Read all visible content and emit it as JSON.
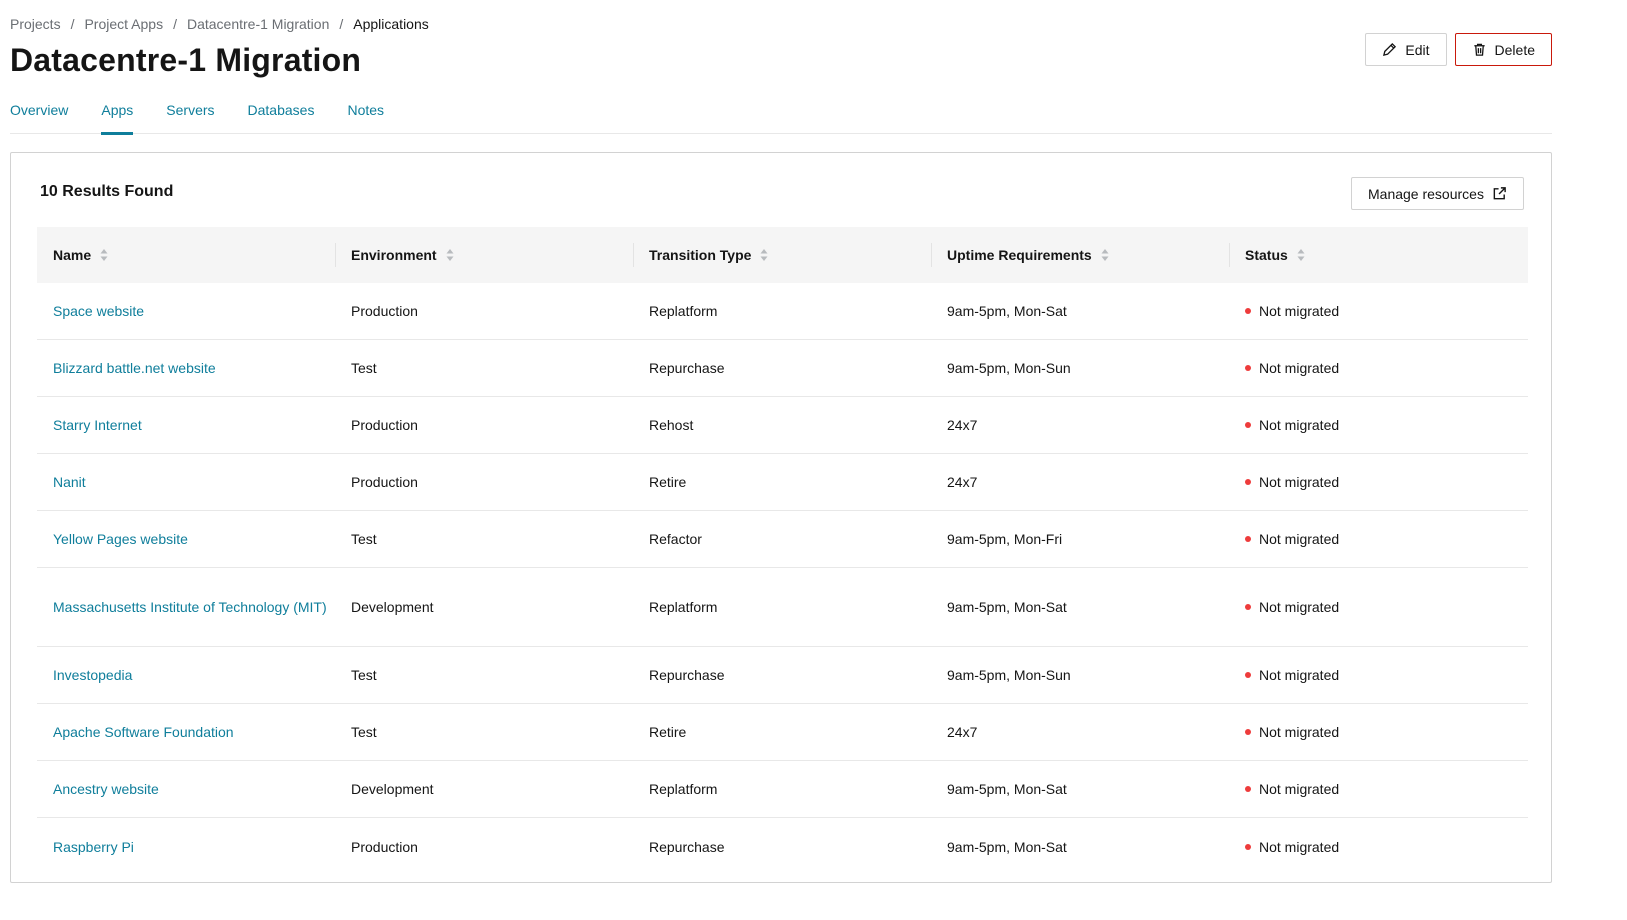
{
  "breadcrumb": [
    "Projects",
    "Project Apps",
    "Datacentre-1 Migration",
    "Applications"
  ],
  "page": {
    "title": "Datacentre-1 Migration"
  },
  "actions": {
    "edit_label": "Edit",
    "delete_label": "Delete"
  },
  "tabs": [
    {
      "label": "Overview",
      "active": false
    },
    {
      "label": "Apps",
      "active": true
    },
    {
      "label": "Servers",
      "active": false
    },
    {
      "label": "Databases",
      "active": false
    },
    {
      "label": "Notes",
      "active": false
    }
  ],
  "card": {
    "results": "10 Results Found",
    "manage_label": "Manage resources"
  },
  "table": {
    "columns": [
      "Name",
      "Environment",
      "Transition Type",
      "Uptime Requirements",
      "Status"
    ],
    "rows": [
      {
        "name": "Space website",
        "environment": "Production",
        "transition": "Replatform",
        "uptime": "9am-5pm, Mon-Sat",
        "status": "Not migrated"
      },
      {
        "name": "Blizzard battle.net website",
        "environment": "Test",
        "transition": "Repurchase",
        "uptime": "9am-5pm, Mon-Sun",
        "status": "Not migrated"
      },
      {
        "name": "Starry Internet",
        "environment": "Production",
        "transition": "Rehost",
        "uptime": "24x7",
        "status": "Not migrated"
      },
      {
        "name": "Nanit",
        "environment": "Production",
        "transition": "Retire",
        "uptime": "24x7",
        "status": "Not migrated"
      },
      {
        "name": "Yellow Pages website",
        "environment": "Test",
        "transition": "Refactor",
        "uptime": "9am-5pm, Mon-Fri",
        "status": "Not migrated"
      },
      {
        "name": "Massachusetts Institute of Technology (MIT)",
        "environment": "Development",
        "transition": "Replatform",
        "uptime": "9am-5pm, Mon-Sat",
        "status": "Not migrated"
      },
      {
        "name": "Investopedia",
        "environment": "Test",
        "transition": "Repurchase",
        "uptime": "9am-5pm, Mon-Sun",
        "status": "Not migrated"
      },
      {
        "name": "Apache Software Foundation",
        "environment": "Test",
        "transition": "Retire",
        "uptime": "24x7",
        "status": "Not migrated"
      },
      {
        "name": "Ancestry website",
        "environment": "Development",
        "transition": "Replatform",
        "uptime": "9am-5pm, Mon-Sat",
        "status": "Not migrated"
      },
      {
        "name": "Raspberry Pi",
        "environment": "Production",
        "transition": "Repurchase",
        "uptime": "9am-5pm, Mon-Sat",
        "status": "Not migrated"
      }
    ]
  },
  "colors": {
    "link": "#0f7e9b",
    "danger": "#c9190b",
    "status_dot": "#ee3b3b"
  },
  "icons": {
    "edit": "pencil-icon",
    "delete": "trash-icon",
    "manage": "external-link-icon",
    "sort": "sort-icon"
  }
}
